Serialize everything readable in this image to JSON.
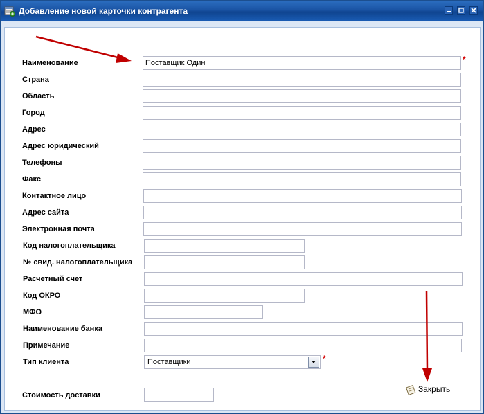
{
  "window": {
    "title": "Добавление новой карточки контрагента"
  },
  "form": {
    "required_mark": "*",
    "fields": [
      {
        "label": "Наименование",
        "value": "Поставщик Один",
        "required": true
      },
      {
        "label": "Страна",
        "value": ""
      },
      {
        "label": "Область",
        "value": ""
      },
      {
        "label": "Город",
        "value": ""
      },
      {
        "label": "Адрес",
        "value": ""
      },
      {
        "label": "Адрес юридический",
        "value": ""
      },
      {
        "label": "Телефоны",
        "value": ""
      },
      {
        "label": "Факс",
        "value": ""
      },
      {
        "label": "Контактное лицо",
        "value": ""
      },
      {
        "label": "Адрес сайта",
        "value": ""
      },
      {
        "label": "Электронная почта",
        "value": ""
      },
      {
        "label": "Код налогоплательщика",
        "value": ""
      },
      {
        "label": "№ свид. налогоплательщика",
        "value": ""
      },
      {
        "label": "Расчетный счет",
        "value": ""
      },
      {
        "label": "Код ОКРО",
        "value": ""
      },
      {
        "label": "МФО",
        "value": ""
      },
      {
        "label": "Наименование банка",
        "value": ""
      },
      {
        "label": "Примечание",
        "value": ""
      }
    ],
    "client_type": {
      "label": "Тип клиента",
      "value": "Поставщики",
      "required": true
    },
    "delivery_cost": {
      "label": "Стоимость доставки",
      "value": ""
    }
  },
  "actions": {
    "close_label": "Закрыть"
  },
  "icons": {
    "window_icon": "card-window-icon",
    "minimize": "minimize-icon",
    "maximize": "maximize-icon",
    "close": "close-icon",
    "dropdown": "chevron-down-icon",
    "close_action": "close-action-icon",
    "annotation": "arrow-annotation"
  },
  "colors": {
    "title_bar": "#1a53a3",
    "window_frame": "#dce7f5",
    "required": "#d40000",
    "annotation_arrow": "#c00000"
  }
}
